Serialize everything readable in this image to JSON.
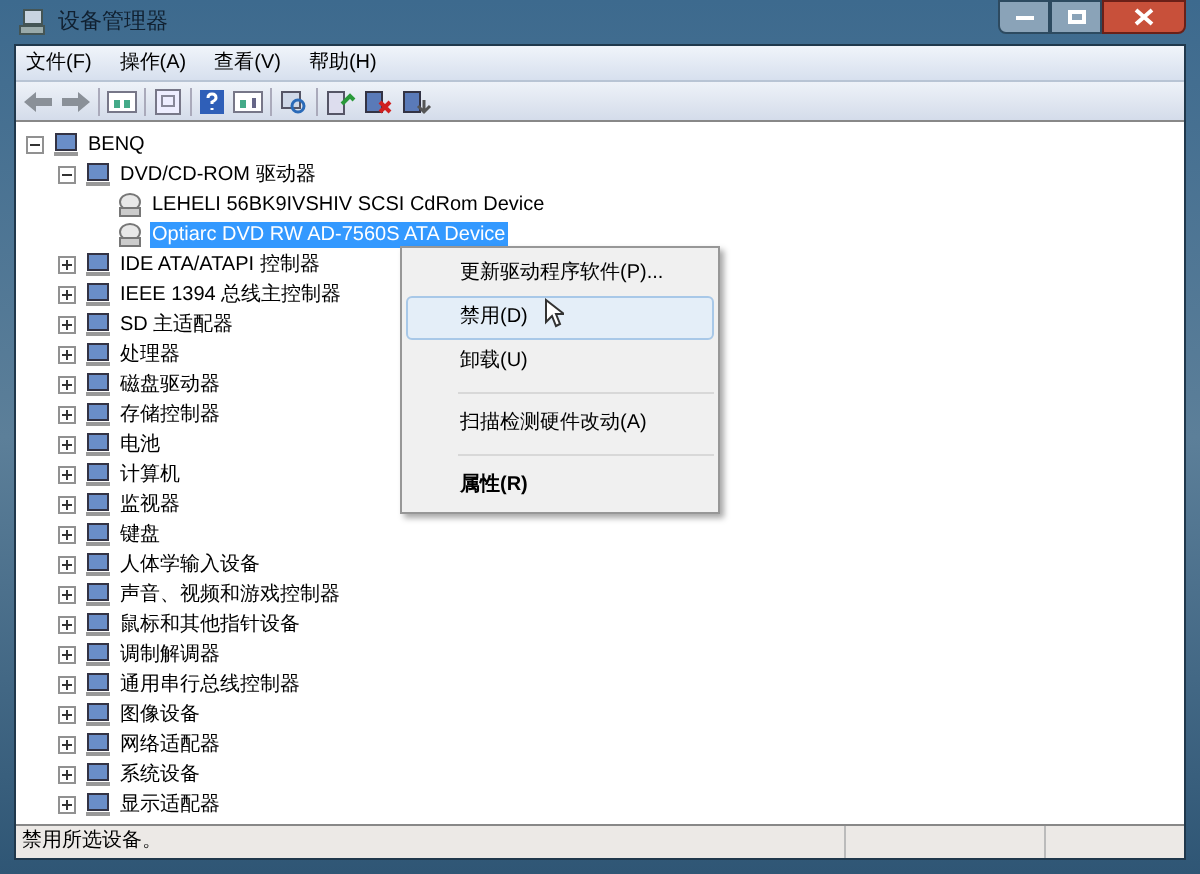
{
  "window": {
    "title": "设备管理器"
  },
  "menu": [
    "文件(F)",
    "操作(A)",
    "查看(V)",
    "帮助(H)"
  ],
  "tree": [
    {
      "label": "BENQ",
      "expanded": true,
      "selected": false,
      "children": [
        {
          "label": "DVD/CD-ROM 驱动器",
          "expanded": true,
          "selected": false,
          "children": [
            {
              "label": "LEHELI 56BK9IVSHIV SCSI CdRom Device",
              "selected": false
            },
            {
              "label": "Optiarc DVD RW AD-7560S ATA Device",
              "selected": true
            }
          ]
        },
        {
          "label": "IDE ATA/ATAPI 控制器",
          "expanded": false,
          "selected": false
        },
        {
          "label": "IEEE 1394 总线主控制器",
          "expanded": false,
          "selected": false
        },
        {
          "label": "SD 主适配器",
          "expanded": false,
          "selected": false
        },
        {
          "label": "处理器",
          "expanded": false,
          "selected": false
        },
        {
          "label": "磁盘驱动器",
          "expanded": false,
          "selected": false
        },
        {
          "label": "存储控制器",
          "expanded": false,
          "selected": false
        },
        {
          "label": "电池",
          "expanded": false,
          "selected": false
        },
        {
          "label": "计算机",
          "expanded": false,
          "selected": false
        },
        {
          "label": "监视器",
          "expanded": false,
          "selected": false
        },
        {
          "label": "键盘",
          "expanded": false,
          "selected": false
        },
        {
          "label": "人体学输入设备",
          "expanded": false,
          "selected": false
        },
        {
          "label": "声音、视频和游戏控制器",
          "expanded": false,
          "selected": false
        },
        {
          "label": "鼠标和其他指针设备",
          "expanded": false,
          "selected": false
        },
        {
          "label": "调制解调器",
          "expanded": false,
          "selected": false
        },
        {
          "label": "通用串行总线控制器",
          "expanded": false,
          "selected": false
        },
        {
          "label": "图像设备",
          "expanded": false,
          "selected": false
        },
        {
          "label": "网络适配器",
          "expanded": false,
          "selected": false
        },
        {
          "label": "系统设备",
          "expanded": false,
          "selected": false
        },
        {
          "label": "显示适配器",
          "expanded": false,
          "selected": false
        }
      ]
    }
  ],
  "context_menu": [
    {
      "kind": "item",
      "label": "更新驱动程序软件(P)...",
      "selected": false,
      "bold": false
    },
    {
      "kind": "item",
      "label": "禁用(D)",
      "selected": true,
      "bold": false
    },
    {
      "kind": "item",
      "label": "卸载(U)",
      "selected": false,
      "bold": false
    },
    {
      "kind": "separator"
    },
    {
      "kind": "item",
      "label": "扫描检测硬件改动(A)",
      "selected": false,
      "bold": false
    },
    {
      "kind": "separator"
    },
    {
      "kind": "item",
      "label": "属性(R)",
      "selected": false,
      "bold": true
    }
  ],
  "status_bar": {
    "text": "禁用所选设备。"
  }
}
